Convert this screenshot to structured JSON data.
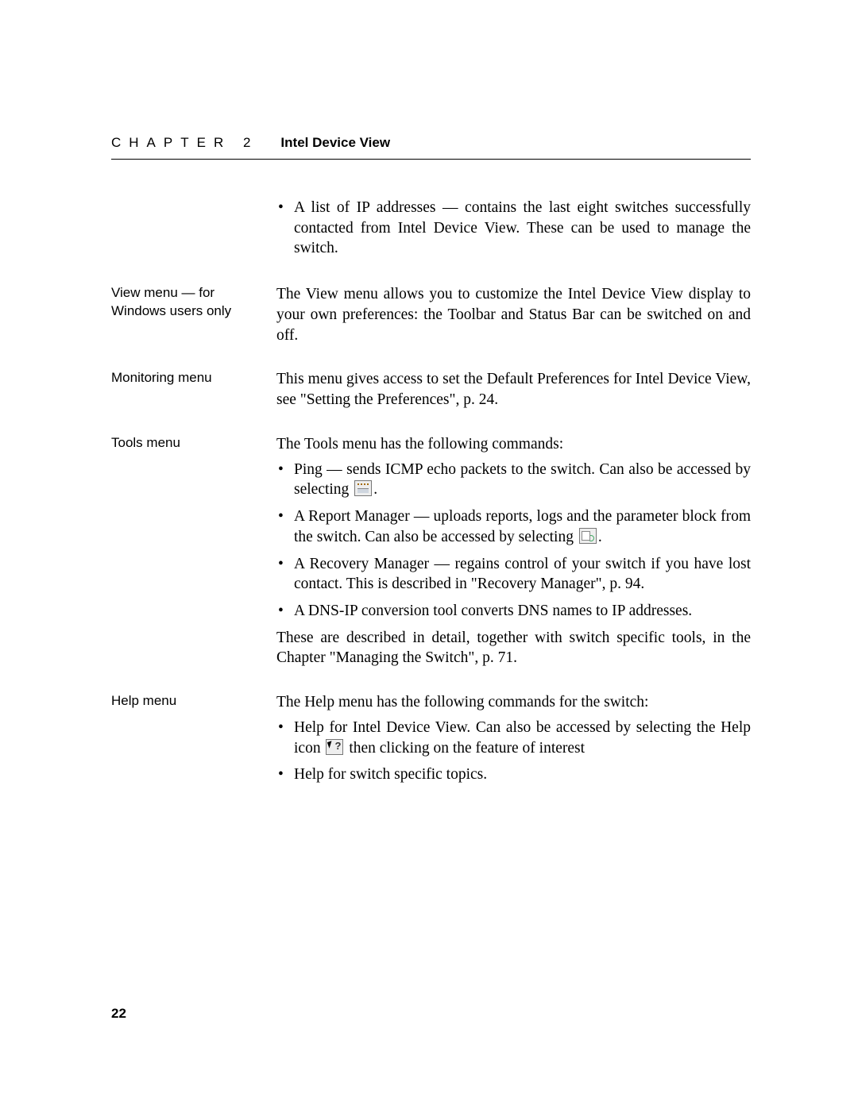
{
  "header": {
    "chapter": "CHAPTER 2",
    "title": "Intel Device View"
  },
  "sections": {
    "ipList": {
      "bullet": "A list of IP addresses — contains the last eight switches successfully contacted from Intel Device View. These can be used to manage the switch."
    },
    "viewMenu": {
      "side": "View menu — for Windows users only",
      "text": "The View menu allows you to customize the Intel Device View display to your own preferences: the Toolbar and Status Bar can be switched on and off."
    },
    "monitoringMenu": {
      "side": "Monitoring menu",
      "text": "This menu gives access to set the Default Preferences for Intel Device View, see \"Setting the Preferences\", p. 24."
    },
    "toolsMenu": {
      "side": "Tools menu",
      "intro": "The Tools menu has the following commands:",
      "items": {
        "ping_a": "Ping — sends ICMP echo packets to the switch. Can also be accessed by selecting ",
        "ping_b": ".",
        "report_a": "A Report Manager — uploads reports, logs and the parameter block from the switch. Can also be accessed by selecting ",
        "report_b": ".",
        "recovery": "A Recovery Manager — regains control of your switch if you have lost contact. This is described in \"Recovery Manager\", p. 94.",
        "dnsip": "A DNS-IP conversion tool converts DNS names to IP addresses."
      },
      "outro": "These are described in detail, together with switch specific tools, in the Chapter  \"Managing the Switch\", p. 71."
    },
    "helpMenu": {
      "side": "Help menu",
      "intro": "The Help menu has the following commands for the switch:",
      "items": {
        "idv_a": "Help for Intel Device View. Can also be accessed by selecting the Help icon ",
        "idv_b": " then clicking on the feature of interest",
        "specific": "Help for switch specific topics."
      }
    }
  },
  "pageNumber": "22"
}
